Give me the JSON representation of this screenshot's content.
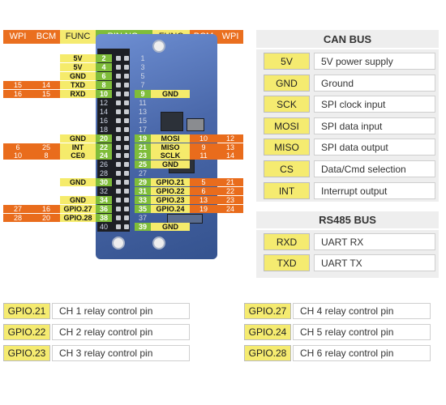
{
  "header": {
    "left": [
      "WPI",
      "BCM",
      "FUNC"
    ],
    "center": "PIN NO.",
    "right": [
      "FUNC",
      "BCM",
      "WPI"
    ]
  },
  "pins": [
    {
      "lfunc": "5V",
      "lnum": "2",
      "rnum": "1",
      "rfunc": "",
      "rbcm": "",
      "rwpi": "",
      "lbcm": "",
      "lwpi": ""
    },
    {
      "lfunc": "5V",
      "lnum": "4",
      "rnum": "3",
      "rfunc": "",
      "rbcm": "",
      "rwpi": "",
      "lbcm": "",
      "lwpi": ""
    },
    {
      "lfunc": "GND",
      "lnum": "6",
      "rnum": "5",
      "rfunc": "",
      "rbcm": "",
      "rwpi": "",
      "lbcm": "",
      "lwpi": ""
    },
    {
      "lfunc": "TXD",
      "lnum": "8",
      "rnum": "7",
      "rfunc": "",
      "rbcm": "",
      "rwpi": "",
      "lbcm": "14",
      "lwpi": "15"
    },
    {
      "lfunc": "RXD",
      "lnum": "10",
      "rnum": "9",
      "rfunc": "GND",
      "rbcm": "",
      "rwpi": "",
      "lbcm": "15",
      "lwpi": "16"
    },
    {
      "lfunc": "",
      "lnum": "12",
      "rnum": "11",
      "rfunc": "",
      "rbcm": "",
      "rwpi": "",
      "lbcm": "",
      "lwpi": ""
    },
    {
      "lfunc": "",
      "lnum": "14",
      "rnum": "13",
      "rfunc": "",
      "rbcm": "",
      "rwpi": "",
      "lbcm": "",
      "lwpi": ""
    },
    {
      "lfunc": "",
      "lnum": "16",
      "rnum": "15",
      "rfunc": "",
      "rbcm": "",
      "rwpi": "",
      "lbcm": "",
      "lwpi": ""
    },
    {
      "lfunc": "",
      "lnum": "18",
      "rnum": "17",
      "rfunc": "",
      "rbcm": "",
      "rwpi": "",
      "lbcm": "",
      "lwpi": ""
    },
    {
      "lfunc": "GND",
      "lnum": "20",
      "rnum": "19",
      "rfunc": "MOSI",
      "rbcm": "10",
      "rwpi": "12",
      "lbcm": "",
      "lwpi": ""
    },
    {
      "lfunc": "INT",
      "lnum": "22",
      "rnum": "21",
      "rfunc": "MISO",
      "rbcm": "9",
      "rwpi": "13",
      "lbcm": "25",
      "lwpi": "6"
    },
    {
      "lfunc": "CE0",
      "lnum": "24",
      "rnum": "23",
      "rfunc": "SCLK",
      "rbcm": "11",
      "rwpi": "14",
      "lbcm": "8",
      "lwpi": "10"
    },
    {
      "lfunc": "",
      "lnum": "26",
      "rnum": "25",
      "rfunc": "GND",
      "rbcm": "",
      "rwpi": "",
      "lbcm": "",
      "lwpi": ""
    },
    {
      "lfunc": "",
      "lnum": "28",
      "rnum": "27",
      "rfunc": "",
      "rbcm": "",
      "rwpi": "",
      "lbcm": "",
      "lwpi": ""
    },
    {
      "lfunc": "GND",
      "lnum": "30",
      "rnum": "29",
      "rfunc": "GPIO.21",
      "rbcm": "5",
      "rwpi": "21",
      "lbcm": "",
      "lwpi": ""
    },
    {
      "lfunc": "",
      "lnum": "32",
      "rnum": "31",
      "rfunc": "GPIO.22",
      "rbcm": "6",
      "rwpi": "22",
      "lbcm": "",
      "lwpi": ""
    },
    {
      "lfunc": "GND",
      "lnum": "34",
      "rnum": "33",
      "rfunc": "GPIO.23",
      "rbcm": "13",
      "rwpi": "23",
      "lbcm": "",
      "lwpi": ""
    },
    {
      "lfunc": "GPIO.27",
      "lnum": "36",
      "rnum": "35",
      "rfunc": "GPIO.24",
      "rbcm": "19",
      "rwpi": "24",
      "lbcm": "16",
      "lwpi": "27"
    },
    {
      "lfunc": "GPIO.28",
      "lnum": "38",
      "rnum": "37",
      "rfunc": "",
      "rbcm": "",
      "rwpi": "",
      "lbcm": "20",
      "lwpi": "28"
    },
    {
      "lfunc": "",
      "lnum": "40",
      "rnum": "39",
      "rfunc": "GND",
      "rbcm": "",
      "rwpi": "",
      "lbcm": "",
      "lwpi": ""
    }
  ],
  "can_bus": {
    "title": "CAN BUS",
    "items": [
      {
        "sig": "5V",
        "desc": "5V power supply"
      },
      {
        "sig": "GND",
        "desc": "Ground"
      },
      {
        "sig": "SCK",
        "desc": "SPI clock input"
      },
      {
        "sig": "MOSI",
        "desc": "SPI data input"
      },
      {
        "sig": "MISO",
        "desc": "SPI data output"
      },
      {
        "sig": "CS",
        "desc": "Data/Cmd selection"
      },
      {
        "sig": "INT",
        "desc": "Interrupt output"
      }
    ]
  },
  "rs485_bus": {
    "title": "RS485 BUS",
    "items": [
      {
        "sig": "RXD",
        "desc": "UART RX"
      },
      {
        "sig": "TXD",
        "desc": "UART TX"
      }
    ]
  },
  "relay_legend": {
    "left": [
      {
        "gpio": "GPIO.21",
        "desc": "CH 1 relay control pin"
      },
      {
        "gpio": "GPIO.22",
        "desc": "CH 2 relay control pin"
      },
      {
        "gpio": "GPIO.23",
        "desc": "CH 3 relay control pin"
      }
    ],
    "right": [
      {
        "gpio": "GPIO.27",
        "desc": "CH 4 relay control pin"
      },
      {
        "gpio": "GPIO.24",
        "desc": "CH 5 relay control pin"
      },
      {
        "gpio": "GPIO.28",
        "desc": "CH 6 relay control pin"
      }
    ]
  },
  "colors": {
    "orange": "#ea6f1f",
    "yellow": "#f5eb70",
    "green": "#7fbd3a",
    "board_blue": "#4a68aa",
    "panel_gray": "#eeeeee"
  }
}
